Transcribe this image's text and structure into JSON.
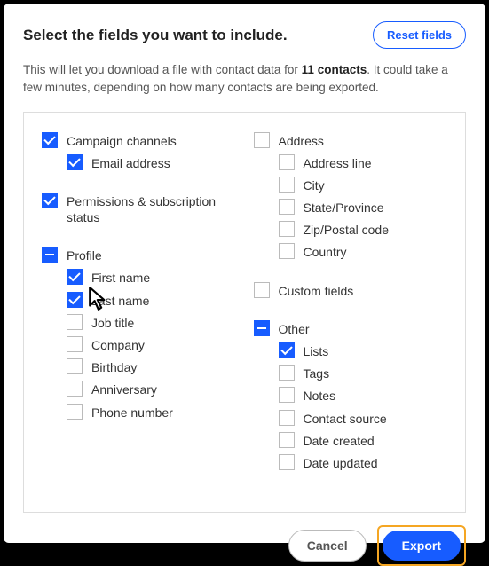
{
  "header": {
    "title": "Select the fields you want to include.",
    "reset_label": "Reset fields"
  },
  "description": {
    "pre": "This will let you download a file with contact data for ",
    "bold": "11 contacts",
    "post": ". It could take a few minutes, depending on how many contacts are being exported."
  },
  "left_groups": [
    {
      "label": "Campaign channels",
      "state": "checked",
      "children": [
        {
          "label": "Email address",
          "state": "checked"
        }
      ]
    },
    {
      "label": "Permissions & subscription status",
      "state": "checked",
      "children": []
    },
    {
      "label": "Profile",
      "state": "indet",
      "children": [
        {
          "label": "First name",
          "state": "checked"
        },
        {
          "label": "Last name",
          "state": "checked"
        },
        {
          "label": "Job title",
          "state": "unchecked"
        },
        {
          "label": "Company",
          "state": "unchecked"
        },
        {
          "label": "Birthday",
          "state": "unchecked"
        },
        {
          "label": "Anniversary",
          "state": "unchecked"
        },
        {
          "label": "Phone number",
          "state": "unchecked"
        }
      ]
    }
  ],
  "right_groups": [
    {
      "label": "Address",
      "state": "unchecked",
      "children": [
        {
          "label": "Address line",
          "state": "unchecked"
        },
        {
          "label": "City",
          "state": "unchecked"
        },
        {
          "label": "State/Province",
          "state": "unchecked"
        },
        {
          "label": "Zip/Postal code",
          "state": "unchecked"
        },
        {
          "label": "Country",
          "state": "unchecked"
        }
      ]
    },
    {
      "label": "Custom fields",
      "state": "unchecked",
      "children": []
    },
    {
      "label": "Other",
      "state": "indet",
      "children": [
        {
          "label": "Lists",
          "state": "checked"
        },
        {
          "label": "Tags",
          "state": "unchecked"
        },
        {
          "label": "Notes",
          "state": "unchecked"
        },
        {
          "label": "Contact source",
          "state": "unchecked"
        },
        {
          "label": "Date created",
          "state": "unchecked"
        },
        {
          "label": "Date updated",
          "state": "unchecked"
        }
      ]
    }
  ],
  "footer": {
    "cancel_label": "Cancel",
    "export_label": "Export"
  }
}
